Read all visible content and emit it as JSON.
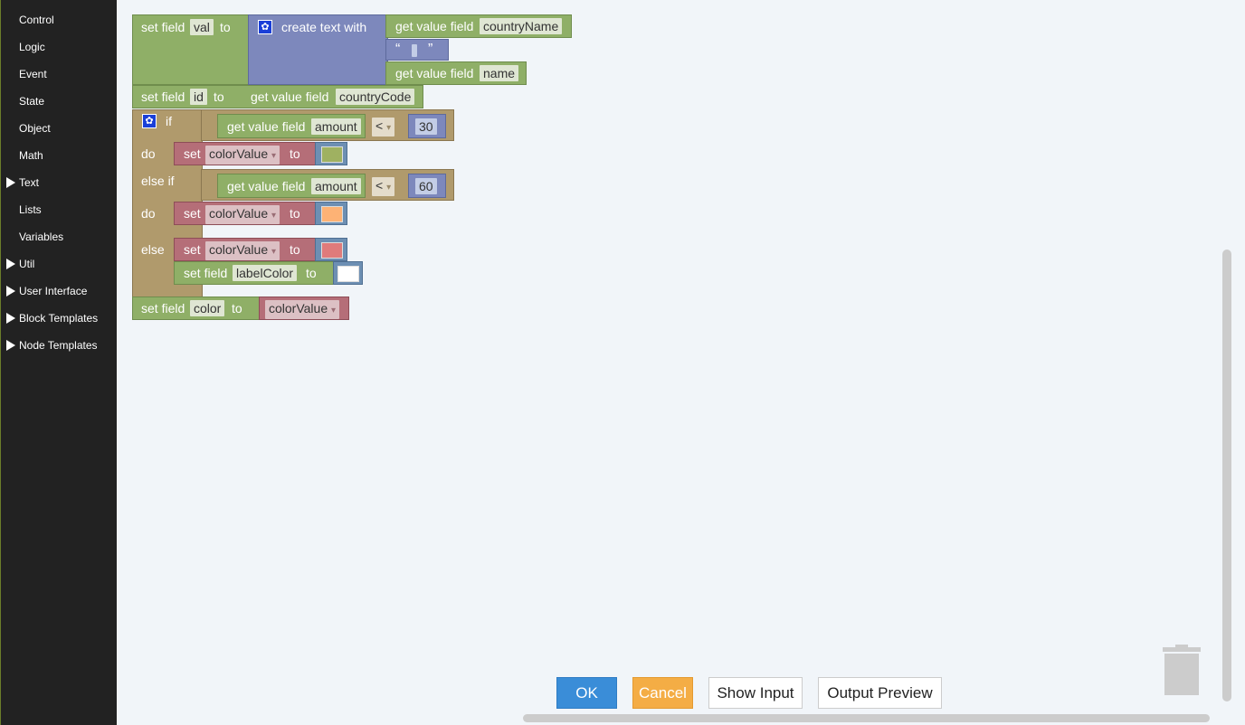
{
  "sidebar": {
    "categories": [
      {
        "label": "Control",
        "expandable": false
      },
      {
        "label": "Logic",
        "expandable": false
      },
      {
        "label": "Event",
        "expandable": false
      },
      {
        "label": "State",
        "expandable": false
      },
      {
        "label": "Object",
        "expandable": false
      },
      {
        "label": "Math",
        "expandable": false
      },
      {
        "label": "Text",
        "expandable": true
      },
      {
        "label": "Lists",
        "expandable": false
      },
      {
        "label": "Variables",
        "expandable": false
      },
      {
        "label": "Util",
        "expandable": true
      },
      {
        "label": "User Interface",
        "expandable": true
      },
      {
        "label": "Block Templates",
        "expandable": true
      },
      {
        "label": "Node Templates",
        "expandable": true
      }
    ]
  },
  "blocks": {
    "set_field": "set field",
    "to": "to",
    "val": "val",
    "create_text_with": "create text with",
    "get_value_field": "get value field",
    "countryName": "countryName",
    "open_quote": "“",
    "close_quote": "”",
    "name": "name",
    "id": "id",
    "countryCode": "countryCode",
    "if": "if",
    "do": "do",
    "else_if": "else if",
    "else": "else",
    "amount": "amount",
    "lt": "<",
    "dropdown_arrow": "▾",
    "value_30": "30",
    "value_60": "60",
    "set": "set",
    "colorValue": "colorValue",
    "labelColor": "labelColor",
    "color": "color"
  },
  "colors": {
    "swatch_1": "#9fb161",
    "swatch_2": "#fdb275",
    "swatch_3": "#e07b7b",
    "swatch_4": "#ffffff"
  },
  "buttons": {
    "ok": "OK",
    "cancel": "Cancel",
    "show_input": "Show Input",
    "output_preview": "Output Preview"
  },
  "icons": {
    "trash": "trash-icon",
    "mutator": "gear-icon"
  }
}
